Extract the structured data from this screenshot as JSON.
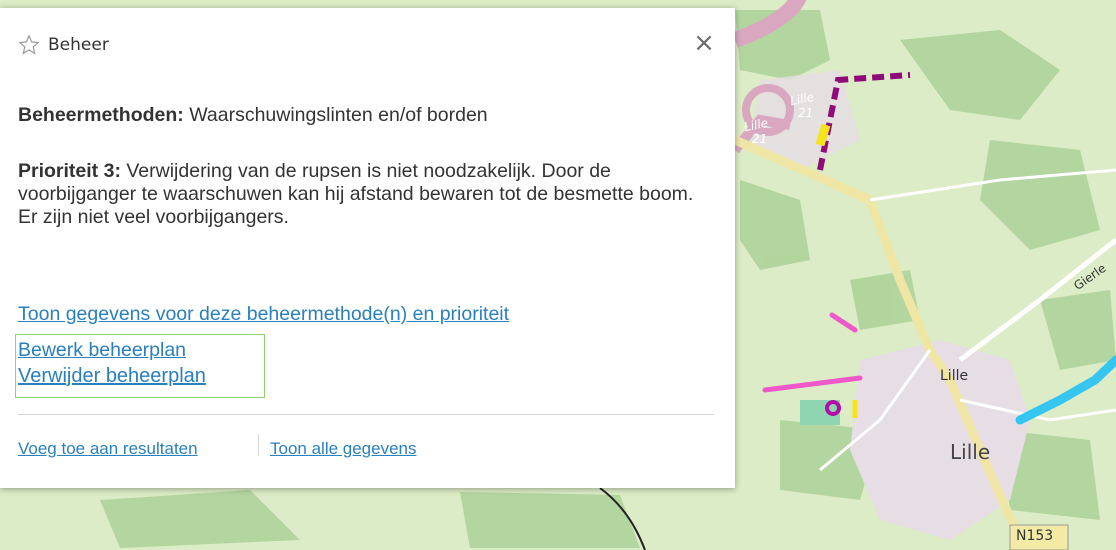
{
  "map": {
    "labels": {
      "lille_21_top": "Lille",
      "lille_21_top_num": "21",
      "lille_21_left": "Lille",
      "lille_21_left_num": "21",
      "lille_small": "Lille",
      "lille_large": "Lille",
      "road_gierle": "Gierle",
      "road_n153": "N153"
    },
    "colors": {
      "background": "#dcecc6",
      "forest": "#aed39a",
      "urban": "#e6dde5",
      "main_road": "#efe6a6",
      "highway": "#d9a8c0",
      "magenta_dashed": "#8e0b79",
      "magenta": "#ef58c8",
      "cyan": "#34c6f0",
      "yellow": "#f7e31c"
    }
  },
  "popup": {
    "title": "Beheer",
    "close_label": "×",
    "methods_label": "Beheermethoden:",
    "methods_value": "Waarschuwingslinten en/of borden",
    "priority_label": "Prioriteit 3:",
    "priority_text": "Verwijdering van de rupsen is niet noodzakelijk. Door de voorbijganger te waarschuwen kan hij afstand bewaren tot de besmette boom. Er zijn niet veel voorbijgangers.",
    "show_data_link": "Toon gegevens voor deze beheermethode(n) en prioriteit",
    "edit_link": "Bewerk beheerplan",
    "delete_link": "Verwijder beheerplan",
    "add_results_link": "Voeg toe aan resultaten",
    "show_all_link": "Toon alle gegevens",
    "icons": {
      "title": "star-icon",
      "close": "close-icon"
    }
  }
}
